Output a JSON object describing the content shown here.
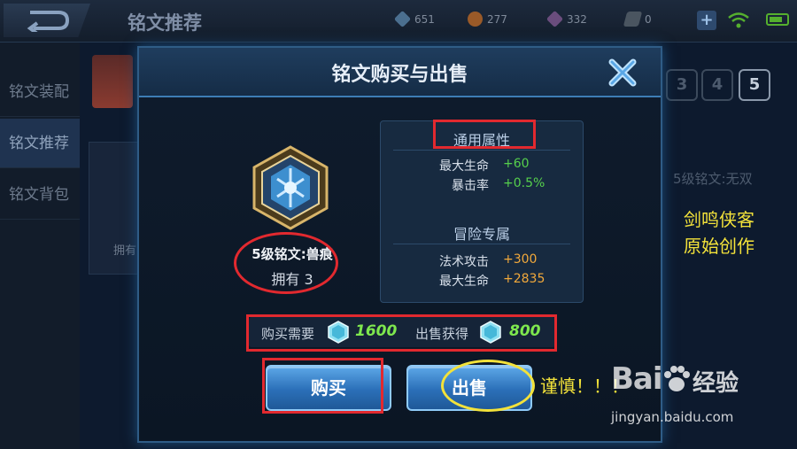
{
  "topbar": {
    "title": "铭文推荐",
    "resources": [
      {
        "icon": "gem-icon",
        "value": "651"
      },
      {
        "icon": "coin-icon",
        "value": "277"
      },
      {
        "icon": "diamond-icon",
        "value": "332"
      },
      {
        "icon": "voucher-icon",
        "value": "0"
      }
    ],
    "plus_label": "+"
  },
  "sidebar": {
    "items": [
      {
        "label": "铭文装配"
      },
      {
        "label": "铭文推荐"
      },
      {
        "label": "铭文背包"
      }
    ]
  },
  "background": {
    "owned_text": "拥有",
    "levels": [
      "3",
      "4",
      "5"
    ],
    "right_text": "5级铭文:无双"
  },
  "dialog": {
    "title": "铭文购买与出售",
    "rune": {
      "name": "5级铭文:兽痕",
      "owned": "拥有 3"
    },
    "general_attr": {
      "header": "通用属性",
      "rows": [
        {
          "label": "最大生命",
          "value": "+60"
        },
        {
          "label": "暴击率",
          "value": "+0.5%"
        }
      ]
    },
    "adventure_attr": {
      "header": "冒险专属",
      "rows": [
        {
          "label": "法术攻击",
          "value": "+300"
        },
        {
          "label": "最大生命",
          "value": "+2835"
        }
      ]
    },
    "price": {
      "buy_label": "购买需要",
      "buy_value": "1600",
      "sell_label": "出售获得",
      "sell_value": "800"
    },
    "buttons": {
      "buy": "购买",
      "sell": "出售"
    }
  },
  "annotations": {
    "author_line1": "剑鸣侠客",
    "author_line2": "原始创作",
    "warning": "谨慎！！！"
  },
  "watermark": {
    "logo": "Bai",
    "logo_cn": "经验",
    "url": "jingyan.baidu.com"
  },
  "colors": {
    "accent_blue": "#2b6fb8",
    "value_green": "#56d04c",
    "value_orange": "#f2a93b",
    "highlight_red": "#e2292f",
    "highlight_yellow": "#f3e23a"
  }
}
